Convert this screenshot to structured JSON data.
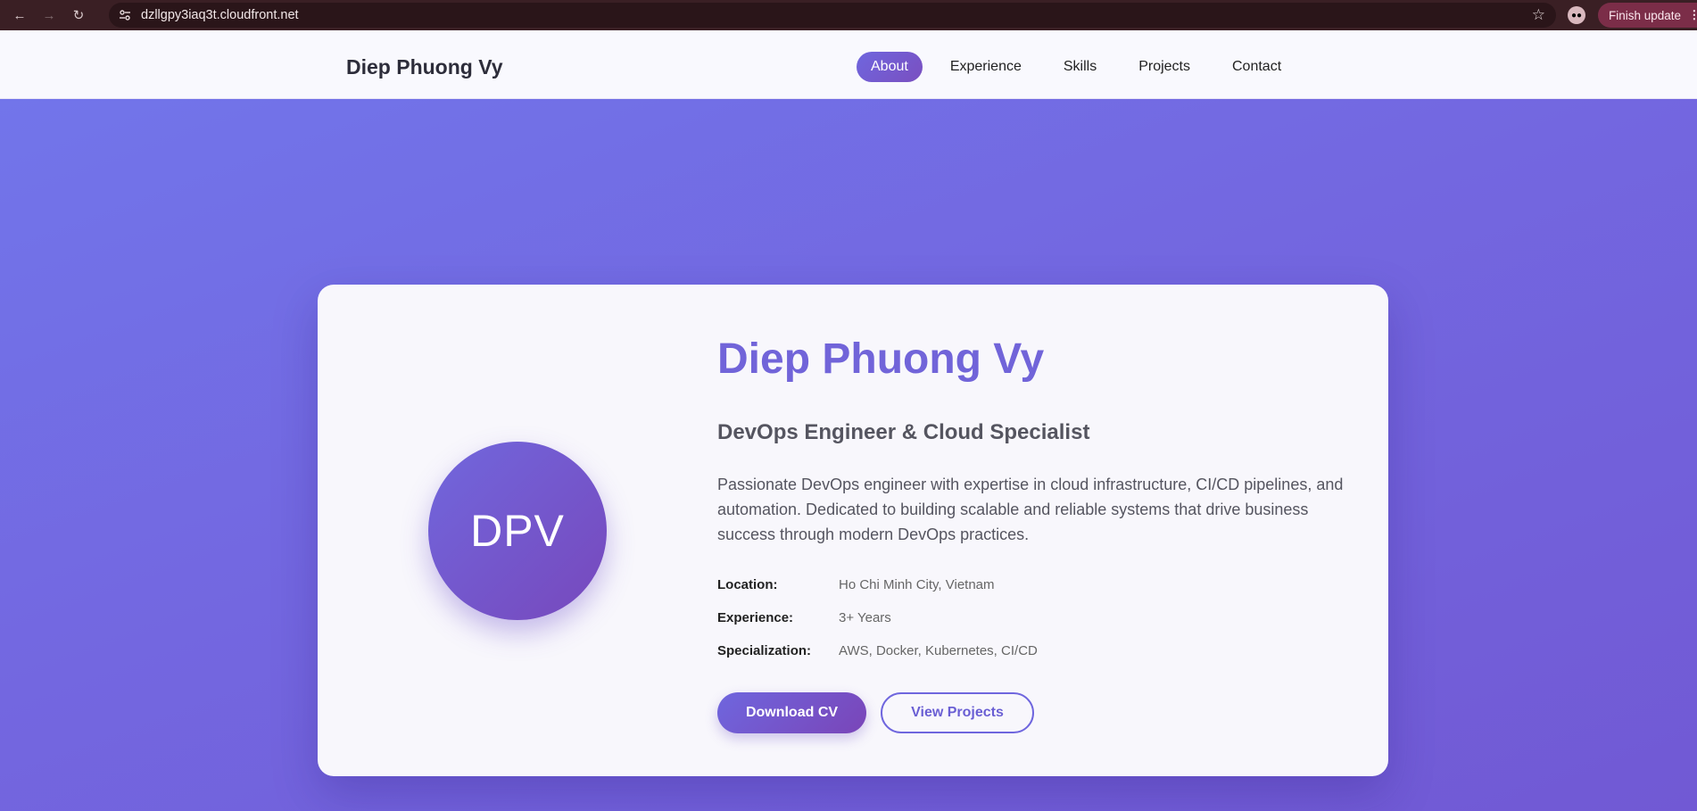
{
  "browser": {
    "url": "dzllgpy3iaq3t.cloudfront.net",
    "update_label": "Finish update"
  },
  "nav": {
    "brand": "Diep Phuong Vy",
    "items": [
      {
        "label": "About",
        "active": true
      },
      {
        "label": "Experience",
        "active": false
      },
      {
        "label": "Skills",
        "active": false
      },
      {
        "label": "Projects",
        "active": false
      },
      {
        "label": "Contact",
        "active": false
      }
    ]
  },
  "hero": {
    "avatar_initials": "DPV",
    "name": "Diep Phuong Vy",
    "title": "DevOps Engineer & Cloud Specialist",
    "bio": "Passionate DevOps engineer with expertise in cloud infrastructure, CI/CD pipelines, and automation. Dedicated to building scalable and reliable systems that drive business success through modern DevOps practices.",
    "details": [
      {
        "label": "Location:",
        "value": "Ho Chi Minh City, Vietnam"
      },
      {
        "label": "Experience:",
        "value": "3+ Years"
      },
      {
        "label": "Specialization:",
        "value": "AWS, Docker, Kubernetes, CI/CD"
      }
    ],
    "primary_button": "Download CV",
    "secondary_button": "View Projects"
  },
  "colors": {
    "accent": "#7164d9",
    "background": "#7367e0"
  }
}
